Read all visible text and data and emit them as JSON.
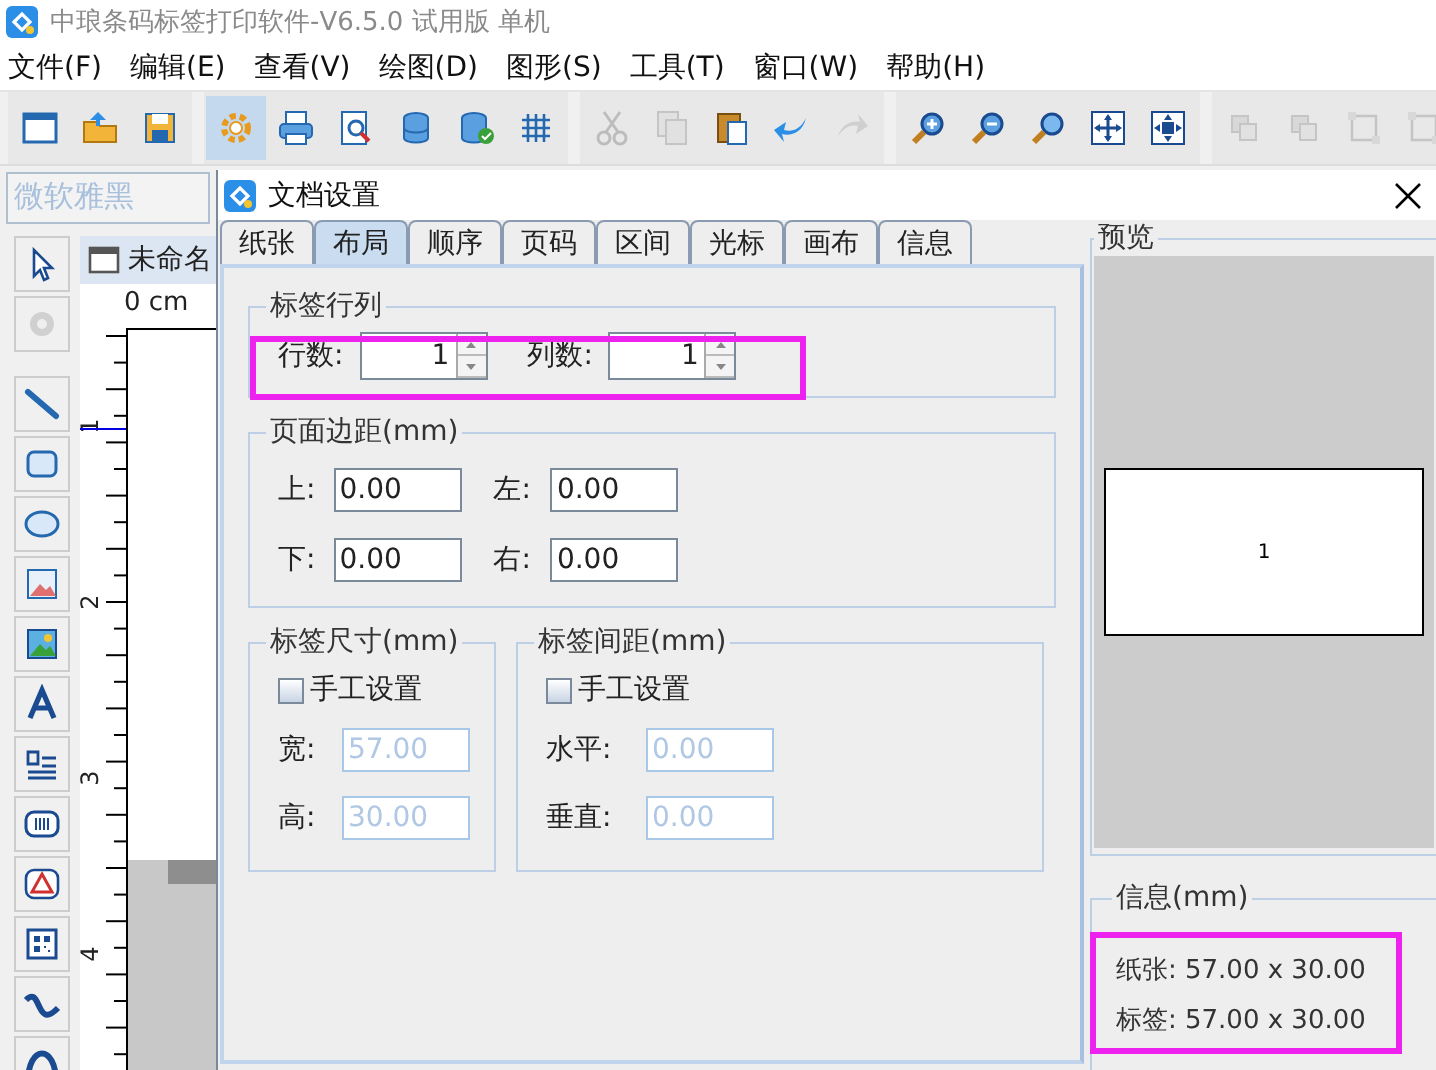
{
  "app": {
    "title": "中琅条码标签打印软件-V6.5.0 试用版 单机"
  },
  "menu": [
    "文件(F)",
    "编辑(E)",
    "查看(V)",
    "绘图(D)",
    "图形(S)",
    "工具(T)",
    "窗口(W)",
    "帮助(H)"
  ],
  "toolbar": [
    {
      "buttons": [
        {
          "kind": "window",
          "disabled": false,
          "selected": false
        },
        {
          "kind": "open",
          "disabled": false,
          "selected": false
        },
        {
          "kind": "save",
          "disabled": false,
          "selected": false
        }
      ]
    },
    {
      "buttons": [
        {
          "kind": "gear",
          "disabled": false,
          "selected": true
        },
        {
          "kind": "print",
          "disabled": false,
          "selected": false
        },
        {
          "kind": "preview",
          "disabled": false,
          "selected": false
        },
        {
          "kind": "database",
          "disabled": false,
          "selected": false
        },
        {
          "kind": "database-check",
          "disabled": false,
          "selected": false
        },
        {
          "kind": "grid",
          "disabled": false,
          "selected": false
        }
      ]
    },
    {
      "buttons": [
        {
          "kind": "cut",
          "disabled": true,
          "selected": false
        },
        {
          "kind": "copy",
          "disabled": true,
          "selected": false
        },
        {
          "kind": "paste",
          "disabled": false,
          "selected": false
        },
        {
          "kind": "undo",
          "disabled": false,
          "selected": false
        },
        {
          "kind": "redo",
          "disabled": true,
          "selected": false
        }
      ]
    },
    {
      "buttons": [
        {
          "kind": "zoom-in",
          "disabled": false,
          "selected": false
        },
        {
          "kind": "zoom-out",
          "disabled": false,
          "selected": false
        },
        {
          "kind": "zoom",
          "disabled": false,
          "selected": false
        },
        {
          "kind": "fit",
          "disabled": false,
          "selected": false
        },
        {
          "kind": "fit2",
          "disabled": false,
          "selected": false
        }
      ]
    },
    {
      "buttons": [
        {
          "kind": "layer",
          "disabled": true,
          "selected": false
        },
        {
          "kind": "layer",
          "disabled": true,
          "selected": false
        },
        {
          "kind": "frame",
          "disabled": true,
          "selected": false
        },
        {
          "kind": "frame",
          "disabled": true,
          "selected": false
        }
      ]
    }
  ],
  "font_box": {
    "value": "微软雅黑",
    "disabled": true
  },
  "tools": [
    {
      "kind": "pointer",
      "disabled": false
    },
    {
      "kind": "rotate",
      "disabled": true
    },
    {
      "kind": "line",
      "disabled": false
    },
    {
      "kind": "rect",
      "disabled": false
    },
    {
      "kind": "ellipse",
      "disabled": false
    },
    {
      "kind": "image",
      "disabled": false
    },
    {
      "kind": "image2",
      "disabled": false
    },
    {
      "kind": "text",
      "disabled": false
    },
    {
      "kind": "richtext",
      "disabled": false
    },
    {
      "kind": "barcode",
      "disabled": false
    },
    {
      "kind": "shape",
      "disabled": false
    },
    {
      "kind": "qr",
      "disabled": false
    },
    {
      "kind": "curve",
      "disabled": false
    },
    {
      "kind": "arc",
      "disabled": false
    }
  ],
  "document": {
    "tab": "未命名",
    "ruler_unit": "0 cm",
    "ruler_marks": [
      "1",
      "2",
      "3",
      "4"
    ]
  },
  "dialog": {
    "title": "文档设置",
    "tabs": [
      {
        "label": "纸张",
        "selected": false
      },
      {
        "label": "布局",
        "selected": true
      },
      {
        "label": "顺序",
        "selected": false
      },
      {
        "label": "页码",
        "selected": false
      },
      {
        "label": "区间",
        "selected": false
      },
      {
        "label": "光标",
        "selected": false
      },
      {
        "label": "画布",
        "selected": false
      },
      {
        "label": "信息",
        "selected": false
      }
    ],
    "rows_cols": {
      "title": "标签行列",
      "highlighted": true,
      "fields": [
        {
          "label": "行数:",
          "value": "1"
        },
        {
          "label": "列数:",
          "value": "1"
        }
      ]
    },
    "margins": {
      "title": "页面边距(mm)",
      "rows": [
        [
          {
            "label": "上:",
            "value": "0.00"
          },
          {
            "label": "左:",
            "value": "0.00"
          }
        ],
        [
          {
            "label": "下:",
            "value": "0.00"
          },
          {
            "label": "右:",
            "value": "0.00"
          }
        ]
      ]
    },
    "label_size": {
      "title": "标签尺寸(mm)",
      "manual": {
        "label": "手工设置",
        "checked": false
      },
      "fields": [
        {
          "label": "宽:",
          "value": "57.00",
          "disabled": true
        },
        {
          "label": "高:",
          "value": "30.00",
          "disabled": true
        }
      ]
    },
    "label_gap": {
      "title": "标签间距(mm)",
      "manual": {
        "label": "手工设置",
        "checked": false
      },
      "fields": [
        {
          "label": "水平:",
          "value": "0.00",
          "disabled": true
        },
        {
          "label": "垂直:",
          "value": "0.00",
          "disabled": true
        }
      ]
    },
    "preview": {
      "title": "预览",
      "label": "1"
    },
    "info": {
      "title": "信息(mm)",
      "highlighted": true,
      "lines": [
        "纸张: 57.00 x 30.00",
        "标签: 57.00 x 30.00"
      ]
    }
  }
}
